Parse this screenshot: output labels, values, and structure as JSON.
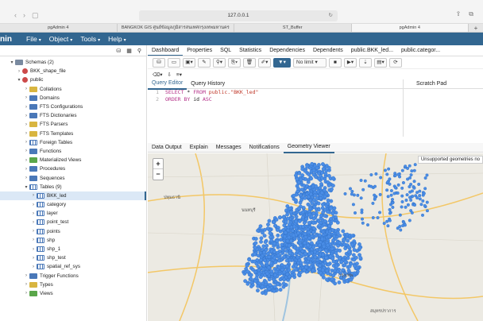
{
  "browser": {
    "url": "127.0.0.1",
    "tabs": [
      "pgAdmin 4",
      "BANGKOK GIS ศูนย์ข้อมูลภูมิสารสนเทศกรุงเทพมหานคร",
      "ST_Buffer",
      "pgAdmin 4"
    ],
    "active_tab": 3
  },
  "app": {
    "logo": "nin",
    "menu": [
      "File",
      "Object",
      "Tools",
      "Help"
    ]
  },
  "tree": [
    {
      "label": "Schemas (2)",
      "indent": 1,
      "toggle": "▾",
      "icon": "folder"
    },
    {
      "label": "BKK_shape_file",
      "indent": 2,
      "toggle": "›",
      "icon": "red"
    },
    {
      "label": "public",
      "indent": 2,
      "toggle": "▾",
      "icon": "red"
    },
    {
      "label": "Collations",
      "indent": 3,
      "toggle": "›",
      "icon": "yellow"
    },
    {
      "label": "Domains",
      "indent": 3,
      "toggle": "›",
      "icon": "blue"
    },
    {
      "label": "FTS Configurations",
      "indent": 3,
      "toggle": "›",
      "icon": "blue"
    },
    {
      "label": "FTS Dictionaries",
      "indent": 3,
      "toggle": "›",
      "icon": "blue"
    },
    {
      "label": "FTS Parsers",
      "indent": 3,
      "toggle": "›",
      "icon": "yellow"
    },
    {
      "label": "FTS Templates",
      "indent": 3,
      "toggle": "›",
      "icon": "yellow"
    },
    {
      "label": "Foreign Tables",
      "indent": 3,
      "toggle": "›",
      "icon": "grid"
    },
    {
      "label": "Functions",
      "indent": 3,
      "toggle": "›",
      "icon": "blue"
    },
    {
      "label": "Materialized Views",
      "indent": 3,
      "toggle": "›",
      "icon": "green"
    },
    {
      "label": "Procedures",
      "indent": 3,
      "toggle": "›",
      "icon": "blue"
    },
    {
      "label": "Sequences",
      "indent": 3,
      "toggle": "›",
      "icon": "blue"
    },
    {
      "label": "Tables (9)",
      "indent": 3,
      "toggle": "▾",
      "icon": "grid"
    },
    {
      "label": "BKK_led",
      "indent": 4,
      "toggle": "›",
      "icon": "grid",
      "selected": true
    },
    {
      "label": "category",
      "indent": 4,
      "toggle": "›",
      "icon": "grid"
    },
    {
      "label": "layer",
      "indent": 4,
      "toggle": "›",
      "icon": "grid"
    },
    {
      "label": "point_test",
      "indent": 4,
      "toggle": "›",
      "icon": "grid"
    },
    {
      "label": "points",
      "indent": 4,
      "toggle": "›",
      "icon": "grid"
    },
    {
      "label": "shp",
      "indent": 4,
      "toggle": "›",
      "icon": "grid"
    },
    {
      "label": "shp_1",
      "indent": 4,
      "toggle": "›",
      "icon": "grid"
    },
    {
      "label": "shp_test",
      "indent": 4,
      "toggle": "›",
      "icon": "grid"
    },
    {
      "label": "spatial_ref_sys",
      "indent": 4,
      "toggle": "›",
      "icon": "grid"
    },
    {
      "label": "Trigger Functions",
      "indent": 3,
      "toggle": "›",
      "icon": "blue"
    },
    {
      "label": "Types",
      "indent": 3,
      "toggle": "›",
      "icon": "yellow"
    },
    {
      "label": "Views",
      "indent": 3,
      "toggle": "›",
      "icon": "green"
    }
  ],
  "main_tabs": [
    "Dashboard",
    "Properties",
    "SQL",
    "Statistics",
    "Dependencies",
    "Dependents",
    "public.BKK_led...",
    "public.categor..."
  ],
  "query": {
    "limit_label": "No limit",
    "editor_tabs": [
      "Query Editor",
      "Query History"
    ],
    "scratch_pad": "Scratch Pad",
    "line1": {
      "kw1": "SELECT",
      "rest": " * ",
      "kw2": "FROM",
      "tbl": " public.\"BKK_led\""
    },
    "line2": {
      "kw1": "ORDER BY",
      "rest": " id ",
      "kw2": "ASC"
    }
  },
  "output_tabs": [
    "Data Output",
    "Explain",
    "Messages",
    "Notifications",
    "Geometry Viewer"
  ],
  "geometry": {
    "unsupported_msg": "Unsupported geometries no",
    "zoom_in": "+",
    "zoom_out": "−",
    "labels": [
      "นนทบุรี",
      "ปทุมธานี",
      "กรุงเทพ",
      "สมุทรปราการ"
    ],
    "point_color": "#4a8de6"
  }
}
